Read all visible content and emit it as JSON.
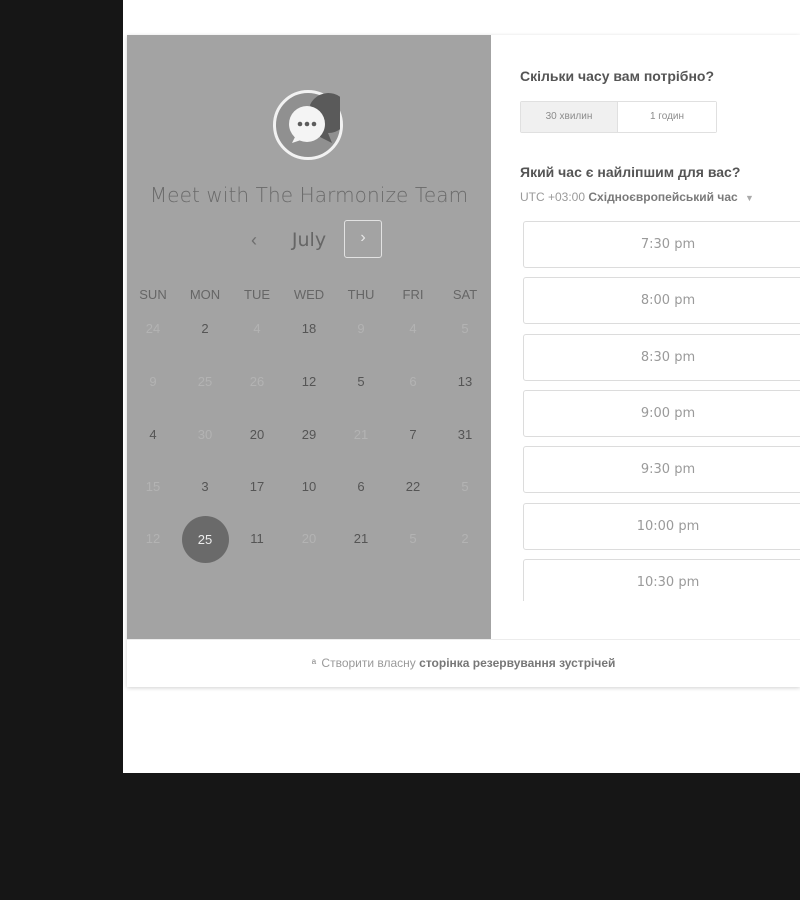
{
  "meeting": {
    "title": "Meet with The Harmonize Team",
    "avatar_icon": "chat-bubble-icon"
  },
  "calendar": {
    "month": "July",
    "prev_icon": "‹",
    "next_icon": "›",
    "weekdays": [
      "SUN",
      "MON",
      "TUE",
      "WED",
      "THU",
      "FRI",
      "SAT"
    ],
    "weeks": [
      [
        {
          "d": "24",
          "m": true
        },
        {
          "d": "2",
          "m": false
        },
        {
          "d": "4",
          "m": true
        },
        {
          "d": "18",
          "m": false
        },
        {
          "d": "9",
          "m": true
        },
        {
          "d": "4",
          "m": true
        },
        {
          "d": "5",
          "m": true
        }
      ],
      [
        {
          "d": "9",
          "m": true
        },
        {
          "d": "25",
          "m": true
        },
        {
          "d": "26",
          "m": true
        },
        {
          "d": "12",
          "m": false
        },
        {
          "d": "5",
          "m": false
        },
        {
          "d": "6",
          "m": true
        },
        {
          "d": "13",
          "m": false
        }
      ],
      [
        {
          "d": "4",
          "m": false
        },
        {
          "d": "30",
          "m": true
        },
        {
          "d": "20",
          "m": false
        },
        {
          "d": "29",
          "m": false
        },
        {
          "d": "21",
          "m": true
        },
        {
          "d": "7",
          "m": false
        },
        {
          "d": "31",
          "m": false
        }
      ],
      [
        {
          "d": "15",
          "m": true
        },
        {
          "d": "3",
          "m": false
        },
        {
          "d": "17",
          "m": false
        },
        {
          "d": "10",
          "m": false
        },
        {
          "d": "6",
          "m": false
        },
        {
          "d": "22",
          "m": false
        },
        {
          "d": "5",
          "m": true
        }
      ],
      [
        {
          "d": "12",
          "m": true
        },
        {
          "d": "25",
          "m": false,
          "selected": true
        },
        {
          "d": "11",
          "m": false
        },
        {
          "d": "20",
          "m": true
        },
        {
          "d": "21",
          "m": false
        },
        {
          "d": "5",
          "m": true
        },
        {
          "d": "2",
          "m": true
        }
      ]
    ]
  },
  "duration": {
    "question": "Скільки часу вам потрібно?",
    "options": [
      "30 хвилин",
      "1 годин"
    ],
    "selected": "30 хвилин"
  },
  "time": {
    "question": "Який час є найліпшим для вас?",
    "timezone_prefix": "UTC +03:00",
    "timezone_name": "Східноєвропейський час",
    "slots": [
      "7:30 pm",
      "8:00 pm",
      "8:30 pm",
      "9:00 pm",
      "9:30 pm",
      "10:00 pm",
      "10:30 pm"
    ]
  },
  "footer": {
    "prefix": "Створити власну",
    "link": "сторінка резервування зустрічей"
  }
}
